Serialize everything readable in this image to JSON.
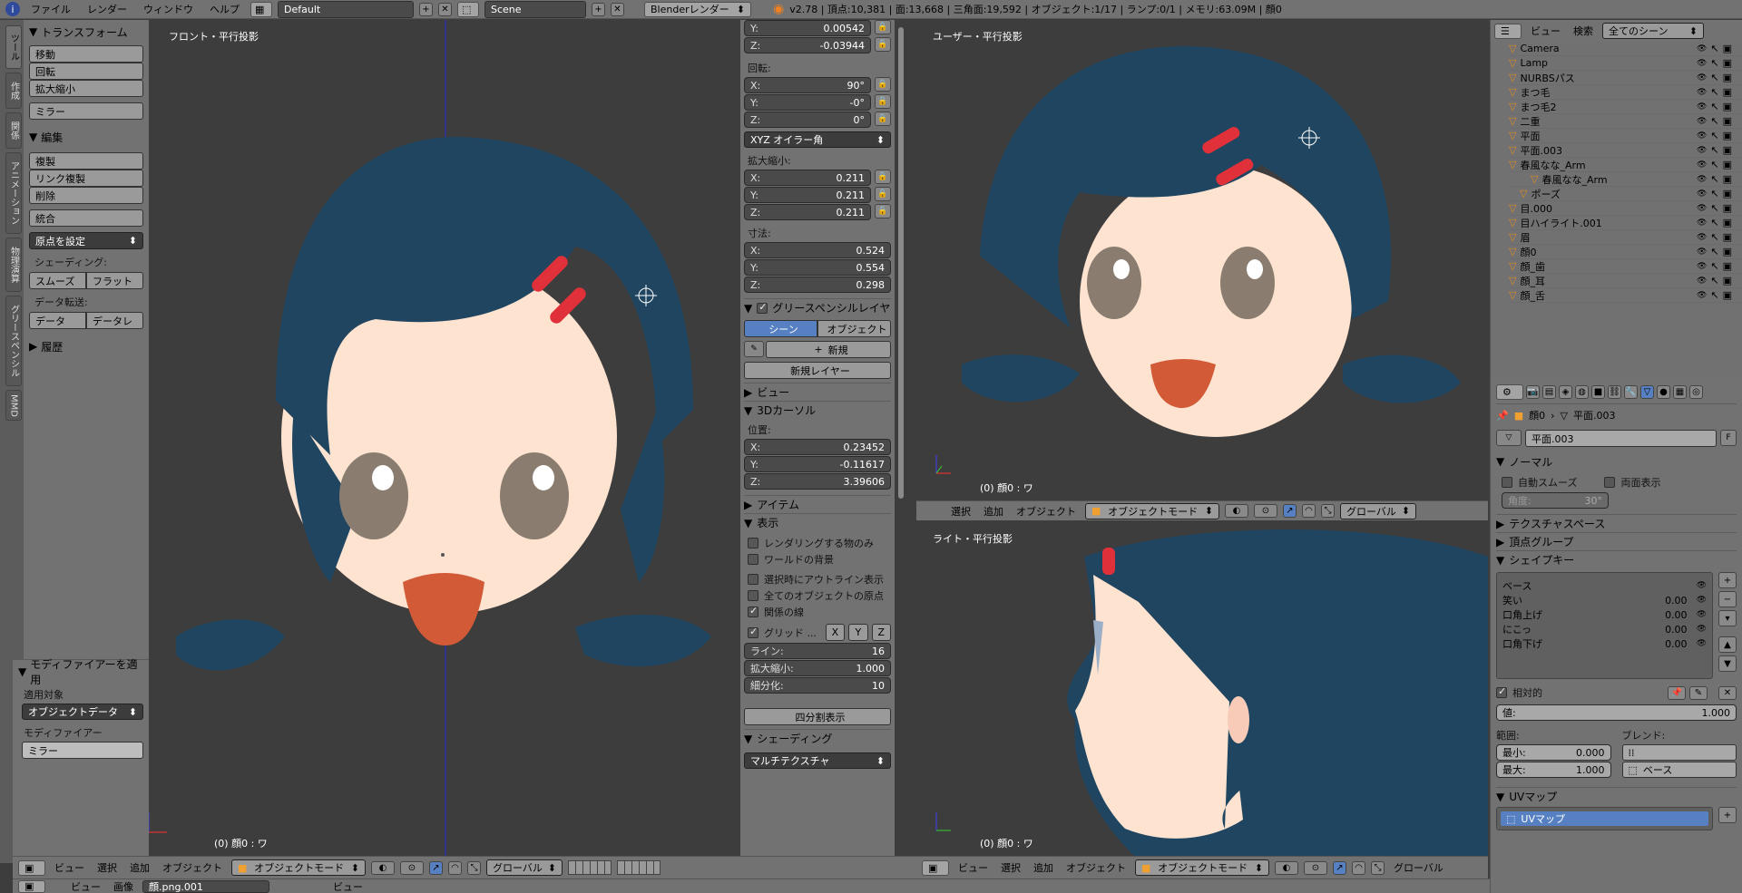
{
  "topbar": {
    "info_icon": "info-icon",
    "menus": [
      "ファイル",
      "レンダー",
      "ウィンドウ",
      "ヘルプ"
    ],
    "layout": "Default",
    "scene": "Scene",
    "engine": "Blenderレンダー",
    "stats": "v2.78 | 頂点:10,381 | 面:13,668 | 三角面:19,592 | オブジェクト:1/17 | ランプ:0/1 | メモリ:63.09M | 顔0"
  },
  "tool_tabs": [
    "ツール",
    "作成",
    "関係",
    "アニメーション",
    "物理演算",
    "グリースペンシル",
    "MMD"
  ],
  "tool_panel": {
    "transform_header": "トランスフォーム",
    "move": "移動",
    "rotate": "回転",
    "scale": "拡大縮小",
    "mirror": "ミラー",
    "edit_header": "編集",
    "duplicate": "複製",
    "link_duplicate": "リンク複製",
    "delete": "削除",
    "join": "統合",
    "set_origin": "原点を設定",
    "shading_label": "シェーディング:",
    "smooth": "スムーズ",
    "flat": "フラット",
    "data_transfer_label": "データ転送:",
    "data": "データ",
    "data_layout": "データレ",
    "history": "履歴",
    "modifier_header": "モディファイアーを適用",
    "apply_target_label": "適用対象",
    "apply_target": "オブジェクトデータ",
    "modifier_label": "モディファイアー",
    "modifier": "ミラー"
  },
  "viewport_front": {
    "label": "フロント・平行投影",
    "object_label": "(0) 顔0 : ワ"
  },
  "properties_n": {
    "loc_y": {
      "label": "Y:",
      "value": "0.00542"
    },
    "loc_z": {
      "label": "Z:",
      "value": "-0.03944"
    },
    "rotation_label": "回転:",
    "rot_x": {
      "label": "X:",
      "value": "90°"
    },
    "rot_y": {
      "label": "Y:",
      "value": "-0°"
    },
    "rot_z": {
      "label": "Z:",
      "value": "0°"
    },
    "rot_mode": "XYZ オイラー角",
    "scale_label": "拡大縮小:",
    "sc_x": {
      "label": "X:",
      "value": "0.211"
    },
    "sc_y": {
      "label": "Y:",
      "value": "0.211"
    },
    "sc_z": {
      "label": "Z:",
      "value": "0.211"
    },
    "dim_label": "寸法:",
    "dim_x": {
      "label": "X:",
      "value": "0.524"
    },
    "dim_y": {
      "label": "Y:",
      "value": "0.554"
    },
    "dim_z": {
      "label": "Z:",
      "value": "0.298"
    },
    "grease_header": "グリースペンシルレイヤ",
    "scene_tab": "シーン",
    "object_tab": "オブジェクト",
    "new": "新規",
    "new_layer": "新規レイヤー",
    "view_header": "ビュー",
    "cursor_header": "3Dカーソル",
    "position_label": "位置:",
    "cur_x": {
      "label": "X:",
      "value": "0.23452"
    },
    "cur_y": {
      "label": "Y:",
      "value": "-0.11617"
    },
    "cur_z": {
      "label": "Z:",
      "value": "3.39606"
    },
    "item_header": "アイテム",
    "display_header": "表示",
    "only_render": "レンダリングする物のみ",
    "world_bg": "ワールドの背景",
    "outline_sel": "選択時にアウトライン表示",
    "all_origins": "全てのオブジェクトの原点",
    "relationship": "関係の線",
    "grid": "グリッド ...",
    "axis_x": "X",
    "axis_y": "Y",
    "axis_z": "Z",
    "lines": {
      "label": "ライン:",
      "value": "16"
    },
    "grid_scale": {
      "label": "拡大縮小:",
      "value": "1.000"
    },
    "subdiv": {
      "label": "細分化:",
      "value": "10"
    },
    "quad_view": "四分割表示",
    "shading_header": "シェーディング",
    "multitexture": "マルチテクスチャ"
  },
  "viewport_user": {
    "label": "ユーザー・平行投影",
    "object_label": "(0) 顔0 : ワ"
  },
  "viewport_right": {
    "label": "ライト・平行投影",
    "object_label": "(0) 顔0 : ワ"
  },
  "view_header": {
    "menus": [
      "ビュー",
      "選択",
      "追加",
      "オブジェクト"
    ],
    "mode": "オブジェクトモード",
    "orientation": "グローバル"
  },
  "mid_header": {
    "menus": [
      "選択",
      "追加",
      "オブジェクト"
    ],
    "mode": "オブジェクトモード",
    "orientation": "グローバル"
  },
  "bottom_right_header": {
    "menus": [
      "ビュー",
      "選択",
      "追加",
      "オブジェクト"
    ],
    "mode": "オブジェクトモード",
    "orientation": "グローバル"
  },
  "outliner": {
    "menus": [
      "ビュー",
      "検索"
    ],
    "filter": "全てのシーン",
    "items": [
      {
        "name": "Camera",
        "indent": 0
      },
      {
        "name": "Lamp",
        "indent": 0
      },
      {
        "name": "NURBSパス",
        "indent": 0
      },
      {
        "name": "まつ毛",
        "indent": 0
      },
      {
        "name": "まつ毛2",
        "indent": 0
      },
      {
        "name": "二重",
        "indent": 0
      },
      {
        "name": "平面",
        "indent": 0
      },
      {
        "name": "平面.003",
        "indent": 0
      },
      {
        "name": "春風なな_Arm",
        "indent": 0
      },
      {
        "name": "春風なな_Arm",
        "indent": 2
      },
      {
        "name": "ポーズ",
        "indent": 1
      },
      {
        "name": "目.000",
        "indent": 0
      },
      {
        "name": "目ハイライト.001",
        "indent": 0
      },
      {
        "name": "眉",
        "indent": 0
      },
      {
        "name": "顔0",
        "indent": 0
      },
      {
        "name": "顔_歯",
        "indent": 0
      },
      {
        "name": "顔_耳",
        "indent": 0
      },
      {
        "name": "顔_舌",
        "indent": 0
      }
    ]
  },
  "props": {
    "crumb_obj": "顔0",
    "crumb_mesh": "平面.003",
    "mesh_name": "平面.003",
    "fake_user": "F",
    "normals_header": "ノーマル",
    "auto_smooth": "自動スムーズ",
    "double_sided": "両面表示",
    "angle": {
      "label": "角度:",
      "value": "30°"
    },
    "tex_space": "テクスチャスペース",
    "vertex_groups": "頂点グループ",
    "shape_keys": "シェイプキー",
    "keys": [
      {
        "name": "ベース",
        "value": ""
      },
      {
        "name": "笑い",
        "value": "0.00"
      },
      {
        "name": "口角上げ",
        "value": "0.00"
      },
      {
        "name": "にこっ",
        "value": "0.00"
      },
      {
        "name": "口角下げ",
        "value": "0.00"
      }
    ],
    "relative": "相対的",
    "value": {
      "label": "値:",
      "value": "1.000"
    },
    "range_label": "範囲:",
    "blend_label": "ブレンド:",
    "min": {
      "label": "最小:",
      "value": "0.000"
    },
    "max": {
      "label": "最大:",
      "value": "1.000"
    },
    "blend_base": "ベース",
    "uv_header": "UVマップ",
    "uv_item": "UVマップ"
  },
  "bottom_strip": {
    "menus": [
      "ビュー",
      "画像"
    ],
    "image": "顔.png.001",
    "view": "ビュー"
  },
  "colors": {
    "hair": "#1f4560",
    "skin": "#fde3d0",
    "clip": "#e0303a",
    "eye": "#8a7c6e"
  }
}
